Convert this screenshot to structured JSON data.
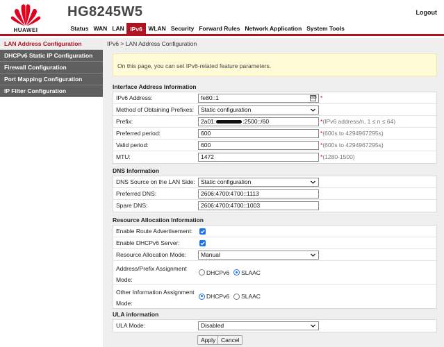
{
  "brand": {
    "logo_text": "HUAWEI",
    "model": "HG8245W5",
    "accent_color": "#b1121d"
  },
  "header": {
    "logout_label": "Logout"
  },
  "nav": {
    "items": [
      "Status",
      "WAN",
      "LAN",
      "IPv6",
      "WLAN",
      "Security",
      "Forward Rules",
      "Network Application",
      "System Tools"
    ],
    "active": "IPv6"
  },
  "sidebar": {
    "items": [
      "LAN Address Configuration",
      "DHCPv6 Static IP Configuration",
      "Firewall Configuration",
      "Port Mapping Configuration",
      "IP Filter Configuration"
    ],
    "active": "LAN Address Configuration"
  },
  "breadcrumb": "IPv6 > LAN Address Configuration",
  "info_text": "On this page, you can set IPv6-related feature parameters.",
  "interface": {
    "title": "Interface Address Information",
    "ipv6_label": "IPv6 Address:",
    "ipv6_value": "fe80::1",
    "method_label": "Method of Obtaining Prefixes:",
    "method_value": "Static configuration",
    "prefix_label": "Prefix:",
    "prefix_value_start": "2a01:",
    "prefix_value_end": ":2500::/60",
    "prefix_hint": "(IPv6 address/n, 1 ≤ n ≤ 64)",
    "preferred_label": "Preferred period:",
    "preferred_value": "600",
    "preferred_hint": "(600s to 4294967295s)",
    "valid_label": "Valid period:",
    "valid_value": "600",
    "valid_hint": "(600s to 4294967295s)",
    "mtu_label": "MTU:",
    "mtu_value": "1472",
    "mtu_hint": "(1280-1500)",
    "required_mark": "*"
  },
  "dns": {
    "title": "DNS Information",
    "source_label": "DNS Source on the LAN Side:",
    "source_value": "Static configuration",
    "preferred_label": "Preferred DNS:",
    "preferred_value": "2606:4700:4700::1113",
    "spare_label": "Spare DNS:",
    "spare_value": "2606:4700:4700::1003"
  },
  "resource": {
    "title": "Resource Allocation Information",
    "route_adv_label": "Enable Route Advertisement:",
    "route_adv_checked": true,
    "dhcpv6_server_label": "Enable DHCPv6 Server:",
    "dhcpv6_server_checked": true,
    "mode_label": "Resource Allocation Mode:",
    "mode_value": "Manual",
    "addr_assign_label_1": "Address/Prefix Assignment",
    "addr_assign_label_2": "Mode:",
    "addr_assign_options": [
      "DHCPv6",
      "SLAAC"
    ],
    "addr_assign_selected": "SLAAC",
    "other_info_label_1": "Other Information Assignment",
    "other_info_label_2": "Mode:",
    "other_info_options": [
      "DHCPv6",
      "SLAAC"
    ],
    "other_info_selected": "DHCPv6"
  },
  "ula": {
    "title": "ULA information",
    "mode_label": "ULA Mode:",
    "mode_value": "Disabled"
  },
  "buttons": {
    "apply": "Apply",
    "cancel": "Cancel"
  }
}
